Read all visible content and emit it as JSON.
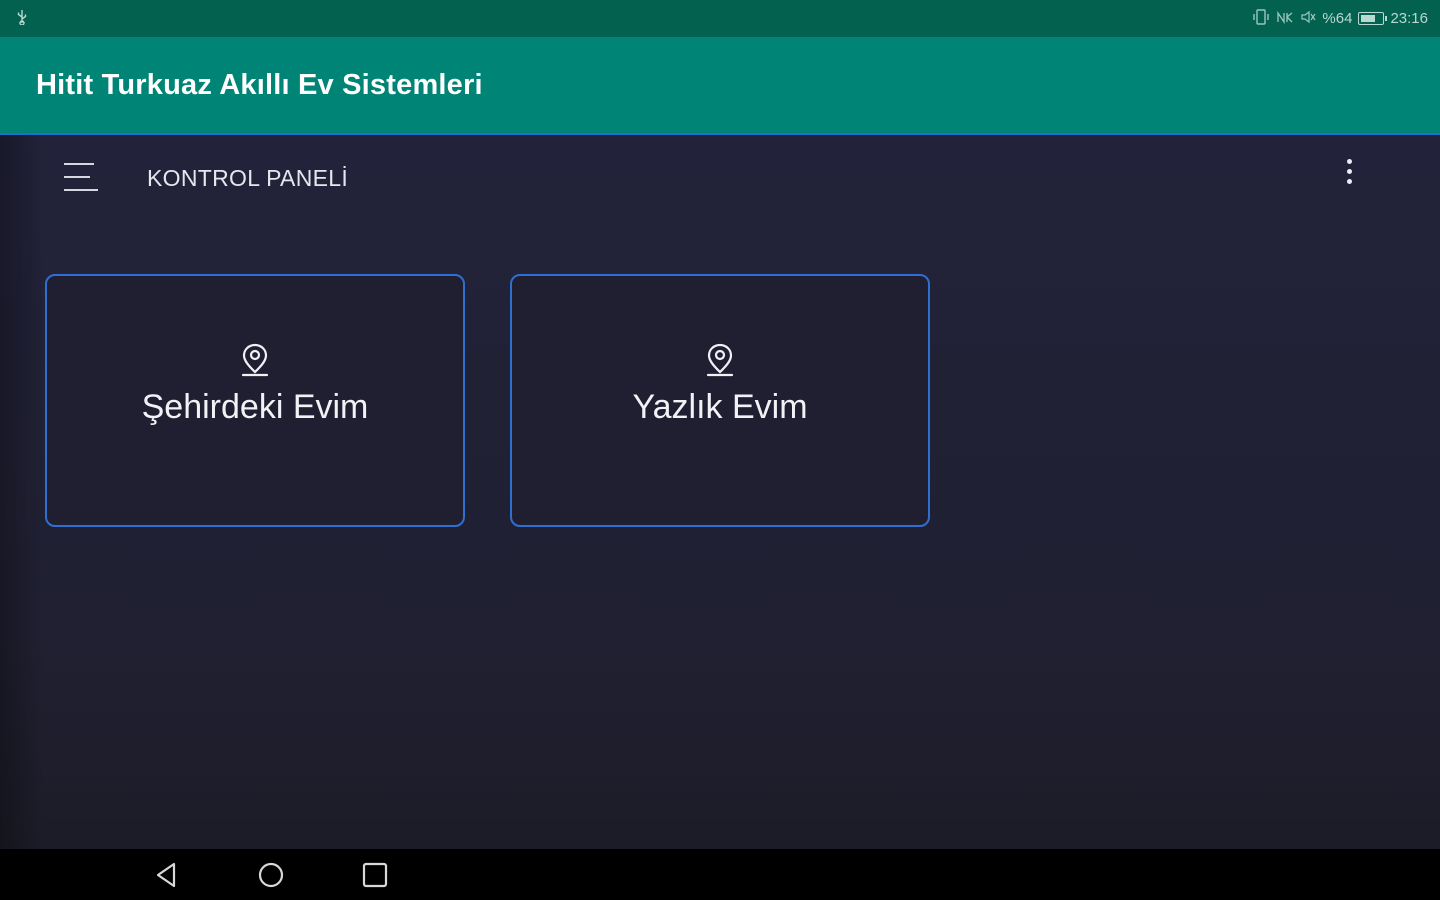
{
  "status_bar": {
    "time": "23:16",
    "battery_text": "%64",
    "left_icon": "usb-icon",
    "right_icons": [
      "vibrate-icon",
      "nfc-icon",
      "mute-icon",
      "battery-icon"
    ]
  },
  "app_bar": {
    "title": "Hitit Turkuaz Akıllı Ev Sistemleri",
    "color": "#008476"
  },
  "toolbar": {
    "menu_icon": "hamburger-menu-icon",
    "title": "KONTROL PANELİ",
    "more_icon": "more-vertical-icon"
  },
  "homes": [
    {
      "label": "Şehirdeki Evim",
      "icon": "location-pin-icon"
    },
    {
      "label": "Yazlık Evim",
      "icon": "location-pin-icon"
    }
  ],
  "colors": {
    "status_bar": "#03614f",
    "background": "#1f1f2e",
    "card_border": "#2f6fcf",
    "nav_bar": "#000000"
  },
  "nav_bar": {
    "buttons": [
      "back-icon",
      "home-icon",
      "recent-apps-icon"
    ]
  }
}
